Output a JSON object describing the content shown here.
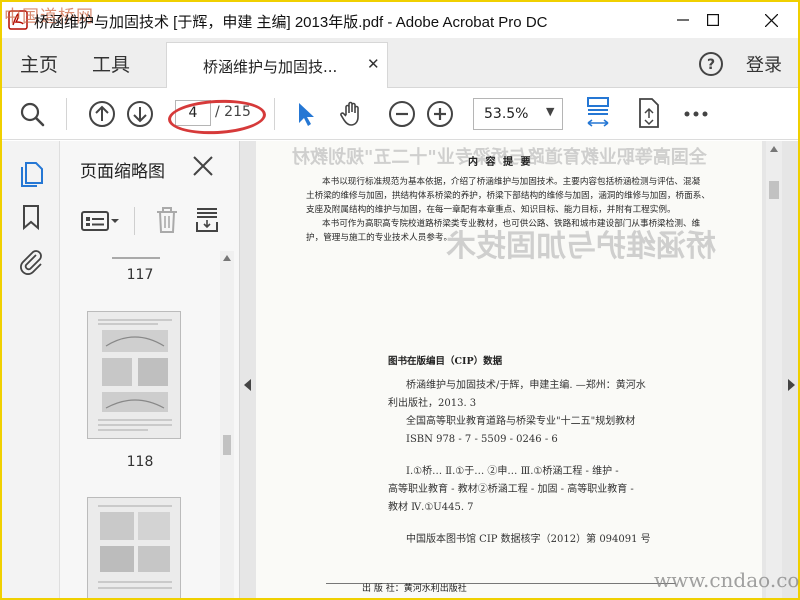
{
  "window": {
    "title": "桥涵维护与加固技术 [于辉，申建 主编] 2013年版.pdf - Adobe Acrobat Pro DC",
    "watermark_top_left": "中国道桥网",
    "watermark_bottom_right": "www.cndao.com"
  },
  "tabs": {
    "home": "主页",
    "tools": "工具",
    "document": "桥涵维护与加固技...",
    "login": "登录"
  },
  "toolbar": {
    "current_page": "4",
    "total_pages": "/ 215",
    "zoom": "53.5%"
  },
  "sidebar": {
    "title": "页面缩略图",
    "thumbnails": [
      {
        "label": "117"
      },
      {
        "label": "118"
      },
      {
        "label": ""
      }
    ]
  },
  "document": {
    "ghost_title": "全国高等职业教育道路与桥梁专业\"十二五\"规划教材",
    "ghost_subtitle": "桥涵维护与加固技术",
    "section_heading": "内 容 提 要",
    "summary_lines": [
      "本书以现行标准规范为基本依据，介绍了桥涵维护与加固技术。主要内容包括桥涵检测与评估、混凝",
      "土桥梁的维修与加固，拱结构体系桥梁的养护，桥梁下部结构的维修与加固，涵洞的维修与加固，桥面系、",
      "支座及附属结构的维护与加固，在每一章配有本章重点、知识目标、能力目标，并附有工程实例。",
      "本书可作为高职高专院校道路桥梁类专业教材，也可供公路、铁路和城市建设部门从事桥梁检测、维",
      "护，管理与施工的专业技术人员参考。"
    ],
    "cip_title": "图书在版编目（CIP）数据",
    "cip_lines": [
      "桥涵维护与加固技术/于辉，申建主编. —郑州：黄河水",
      "利出版社，2013. 3",
      "全国高等职业教育道路与桥梁专业\"十二五\"规划教材",
      "ISBN 978 - 7 - 5509 - 0246 - 6",
      "",
      "Ⅰ.①桥…  Ⅱ.①于…  ②申…  Ⅲ.①桥涵工程 - 维护 -",
      "高等职业教育 - 教材②桥涵工程 - 加固 - 高等职业教育 -",
      "教材  Ⅳ.①U445. 7",
      "",
      "中国版本图书馆 CIP 数据核字（2012）第 094091 号"
    ],
    "publisher_line": "出  版  社：黄河水利出版社"
  }
}
